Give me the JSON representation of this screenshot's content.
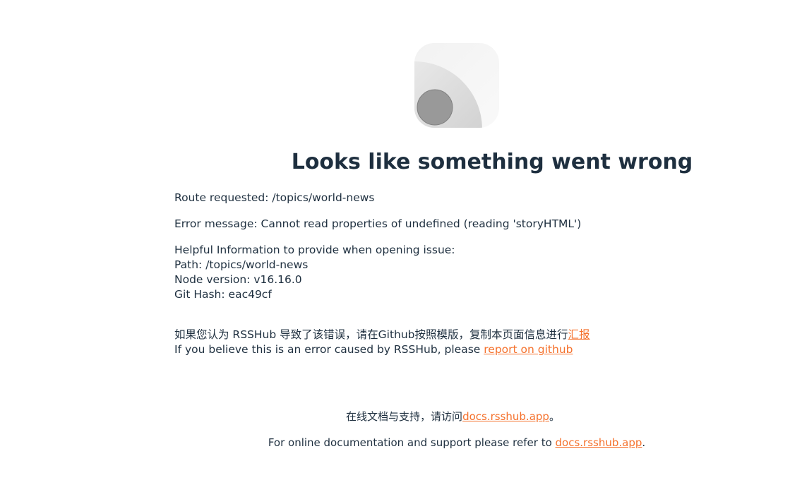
{
  "heading": "Looks like something went wrong",
  "route_label": "Route requested: ",
  "route_value": "/topics/world-news",
  "error_label": "Error message: ",
  "error_value": "Cannot read properties of undefined (reading 'storyHTML')",
  "helpful_heading": "Helpful Information to provide when opening issue:",
  "path_label": "Path: ",
  "path_value": "/topics/world-news",
  "node_label": "Node version: ",
  "node_value": "v16.16.0",
  "git_label": "Git Hash: ",
  "git_value": "eac49cf",
  "report_cn_text": "如果您认为 RSSHub 导致了该错误，请在Github按照模版，复制本页面信息进行",
  "report_cn_link": "汇报",
  "report_en_text": "If you believe this is an error caused by RSSHub, please ",
  "report_en_link": "report on github",
  "footer_cn_text": "在线文档与支持，请访问",
  "footer_cn_link": "docs.rsshub.app",
  "footer_cn_end": "。",
  "footer_en_text": "For online documentation and support please refer to ",
  "footer_en_link": "docs.rsshub.app",
  "footer_en_end": ".",
  "colors": {
    "link": "#f5712c",
    "text": "#1e2f3f"
  },
  "icons": {
    "logo": "rsshub-logo-icon"
  }
}
